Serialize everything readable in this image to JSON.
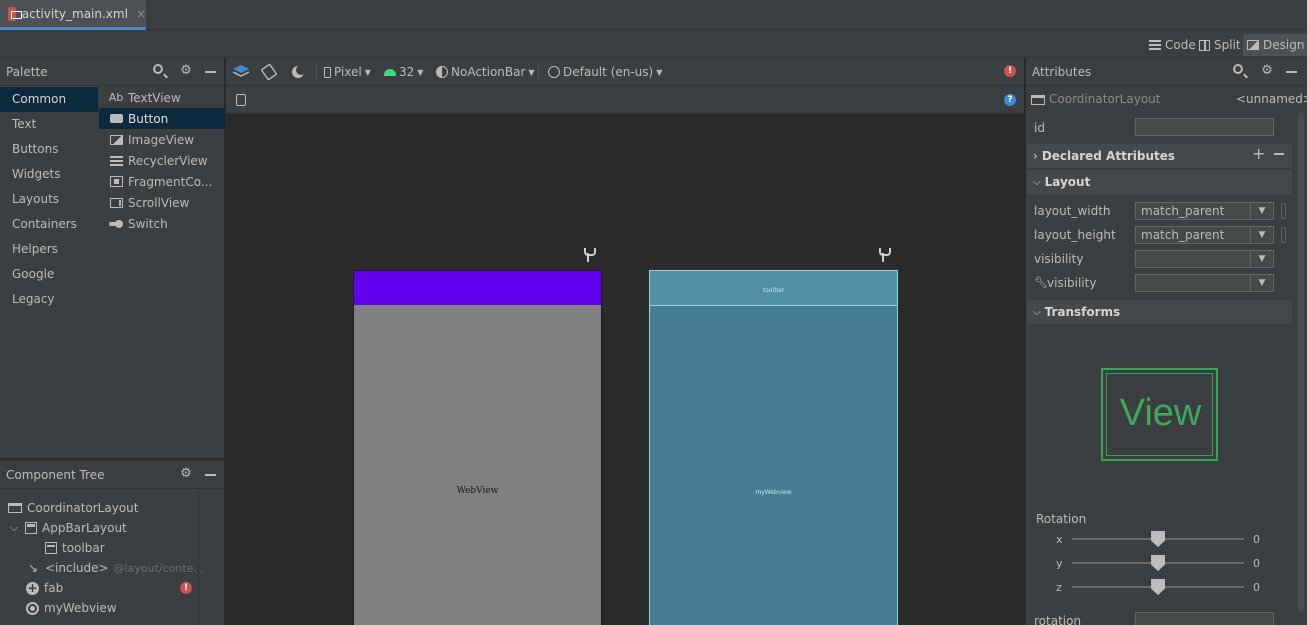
{
  "tab": {
    "filename": "activity_main.xml",
    "close": "×"
  },
  "modes": {
    "code": "Code",
    "split": "Split",
    "design": "Design"
  },
  "palette": {
    "title": "Palette",
    "categories": [
      "Common",
      "Text",
      "Buttons",
      "Widgets",
      "Layouts",
      "Containers",
      "Helpers",
      "Google",
      "Legacy"
    ],
    "widgets": [
      {
        "label": "TextView",
        "icon": "textview-icon",
        "glyph": "Ab"
      },
      {
        "label": "Button",
        "icon": "button-icon"
      },
      {
        "label": "ImageView",
        "icon": "imageview-icon"
      },
      {
        "label": "RecyclerView",
        "icon": "recyclerview-icon"
      },
      {
        "label": "FragmentCo...",
        "icon": "fragmentcontainer-icon"
      },
      {
        "label": "ScrollView",
        "icon": "scrollview-icon"
      },
      {
        "label": "Switch",
        "icon": "switch-icon"
      }
    ]
  },
  "tree": {
    "title": "Component Tree",
    "nodes": [
      {
        "label": "CoordinatorLayout"
      },
      {
        "label": "AppBarLayout"
      },
      {
        "label": "toolbar"
      },
      {
        "label": "<include>",
        "sub": "@layout/conte..."
      },
      {
        "label": "fab"
      },
      {
        "label": "myWebview"
      }
    ]
  },
  "design_toolbar": {
    "device": "Pixel",
    "api": "32",
    "theme": "NoActionBar",
    "locale": "Default (en-us)"
  },
  "canvas": {
    "design_label": "WebView",
    "blueprint_toolbar_label": "toolbar",
    "blueprint_web_label": "myWebview"
  },
  "attributes": {
    "title": "Attributes",
    "component": "CoordinatorLayout",
    "component_name": "<unnamed>",
    "id_label": "id",
    "sections": {
      "declared": "Declared Attributes",
      "layout": "Layout",
      "transforms": "Transforms"
    },
    "rows": [
      {
        "label": "layout_width",
        "value": "match_parent"
      },
      {
        "label": "layout_height",
        "value": "match_parent"
      },
      {
        "label": "visibility",
        "value": ""
      },
      {
        "label": "visibility",
        "value": ""
      }
    ],
    "view_preview": "View",
    "rotation_label": "Rotation",
    "rotation": [
      {
        "axis": "x",
        "value": "0"
      },
      {
        "axis": "y",
        "value": "0"
      },
      {
        "axis": "z",
        "value": "0"
      }
    ],
    "rotation_field_label": "rotation"
  },
  "colors": {
    "accent_purple": "#6200ee",
    "blueprint": "#457e93",
    "error": "#c75450",
    "view_green": "#35a553"
  }
}
